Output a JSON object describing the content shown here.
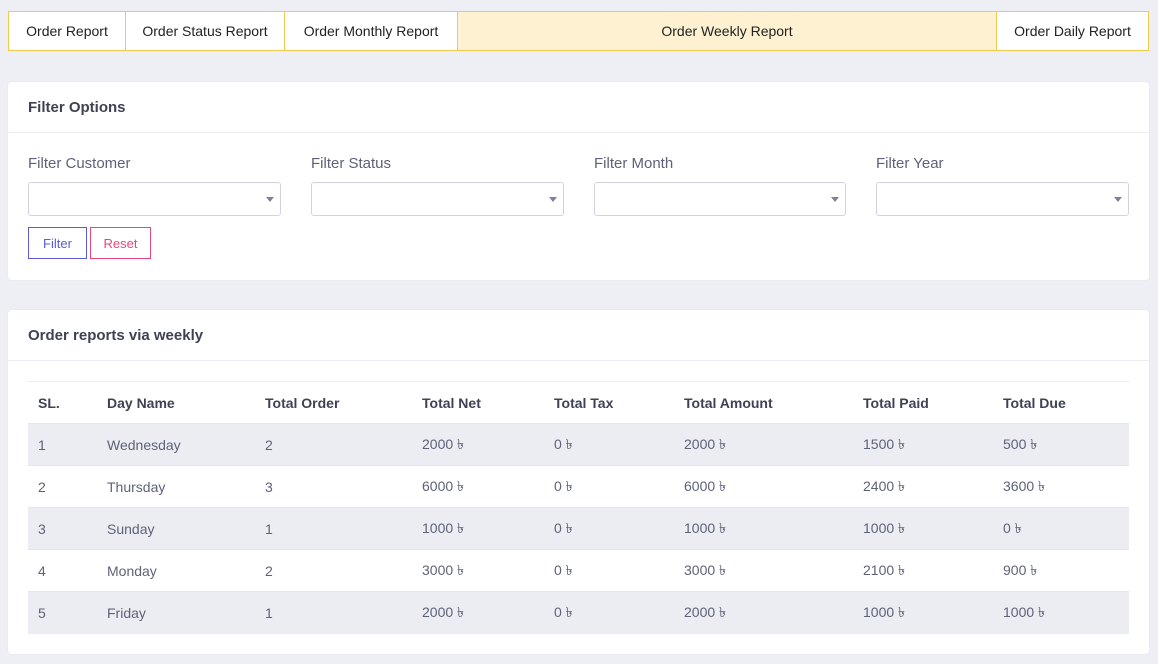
{
  "tabs": [
    {
      "label": "Order Report"
    },
    {
      "label": "Order Status Report"
    },
    {
      "label": "Order Monthly Report"
    },
    {
      "label": "Order Weekly Report"
    },
    {
      "label": "Order Daily Report"
    }
  ],
  "filter_card": {
    "title": "Filter Options",
    "customer_label": "Filter Customer",
    "status_label": "Filter Status",
    "month_label": "Filter Month",
    "year_label": "Filter Year",
    "filter_button": "Filter",
    "reset_button": "Reset"
  },
  "report_card": {
    "title": "Order reports via weekly",
    "columns": [
      "SL.",
      "Day Name",
      "Total Order",
      "Total Net",
      "Total Tax",
      "Total Amount",
      "Total Paid",
      "Total Due"
    ],
    "rows": [
      [
        "1",
        "Wednesday",
        "2",
        "2000 ৳",
        "0 ৳",
        "2000 ৳",
        "1500 ৳",
        "500 ৳"
      ],
      [
        "2",
        "Thursday",
        "3",
        "6000 ৳",
        "0 ৳",
        "6000 ৳",
        "2400 ৳",
        "3600 ৳"
      ],
      [
        "3",
        "Sunday",
        "1",
        "1000 ৳",
        "0 ৳",
        "1000 ৳",
        "1000 ৳",
        "0 ৳"
      ],
      [
        "4",
        "Monday",
        "2",
        "3000 ৳",
        "0 ৳",
        "3000 ৳",
        "2100 ৳",
        "900 ৳"
      ],
      [
        "5",
        "Friday",
        "1",
        "2000 ৳",
        "0 ৳",
        "2000 ৳",
        "1000 ৳",
        "1000 ৳"
      ]
    ]
  }
}
